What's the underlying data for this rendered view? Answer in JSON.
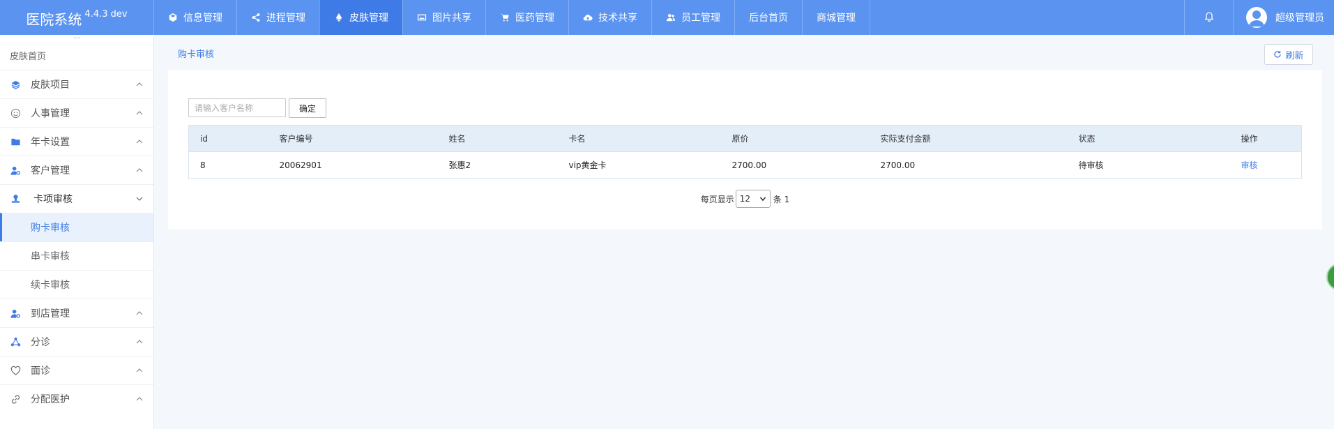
{
  "app": {
    "name": "医院系统",
    "version": "4.4.3 dev"
  },
  "topnav": [
    {
      "label": "信息管理",
      "icon": "cube-icon",
      "active": false
    },
    {
      "label": "进程管理",
      "icon": "share-icon",
      "active": false
    },
    {
      "label": "皮肤管理",
      "icon": "drop-icon",
      "active": true
    },
    {
      "label": "图片共享",
      "icon": "image-icon",
      "active": false
    },
    {
      "label": "医药管理",
      "icon": "cart-icon",
      "active": false
    },
    {
      "label": "技术共享",
      "icon": "cloud-upload-icon",
      "active": false
    },
    {
      "label": "员工管理",
      "icon": "users-icon",
      "active": false
    },
    {
      "label": "后台首页",
      "icon": "",
      "active": false
    },
    {
      "label": "商城管理",
      "icon": "",
      "active": false
    }
  ],
  "user": {
    "name": "超级管理员"
  },
  "sidebar": {
    "home": "皮肤首页",
    "items": [
      {
        "label": "皮肤项目",
        "icon": "layers-icon"
      },
      {
        "label": "人事管理",
        "icon": "smile-icon"
      },
      {
        "label": "年卡设置",
        "icon": "folder-icon"
      },
      {
        "label": "客户管理",
        "icon": "user-gear-icon"
      },
      {
        "label": "卡项审核",
        "icon": "stamp-icon",
        "open": true,
        "children": [
          "购卡审核",
          "串卡审核",
          "续卡审核"
        ],
        "active_child": 0
      },
      {
        "label": "到店管理",
        "icon": "user-gear-icon"
      },
      {
        "label": "分诊",
        "icon": "triangle-nodes-icon"
      },
      {
        "label": "面诊",
        "icon": "heart-icon"
      },
      {
        "label": "分配医护",
        "icon": "link-icon"
      }
    ]
  },
  "main": {
    "breadcrumb": "购卡审核",
    "refresh_label": "刷新",
    "search": {
      "placeholder": "请输入客户名称",
      "value": ""
    },
    "confirm_label": "确定",
    "table": {
      "columns": [
        "id",
        "客户编号",
        "姓名",
        "卡名",
        "原价",
        "实际支付金额",
        "状态",
        "操作"
      ],
      "rows": [
        [
          "8",
          "20062901",
          "张惠2",
          "vip黄金卡",
          "2700.00",
          "2700.00",
          "待审核",
          "审核"
        ]
      ]
    },
    "pager": {
      "per_page_label": "每页显示",
      "per_page": "12",
      "total_label": "条 1"
    }
  },
  "colors": {
    "topbar": "#5a93f0",
    "active_tab": "#3f7be6",
    "accent": "#3f7be6"
  }
}
